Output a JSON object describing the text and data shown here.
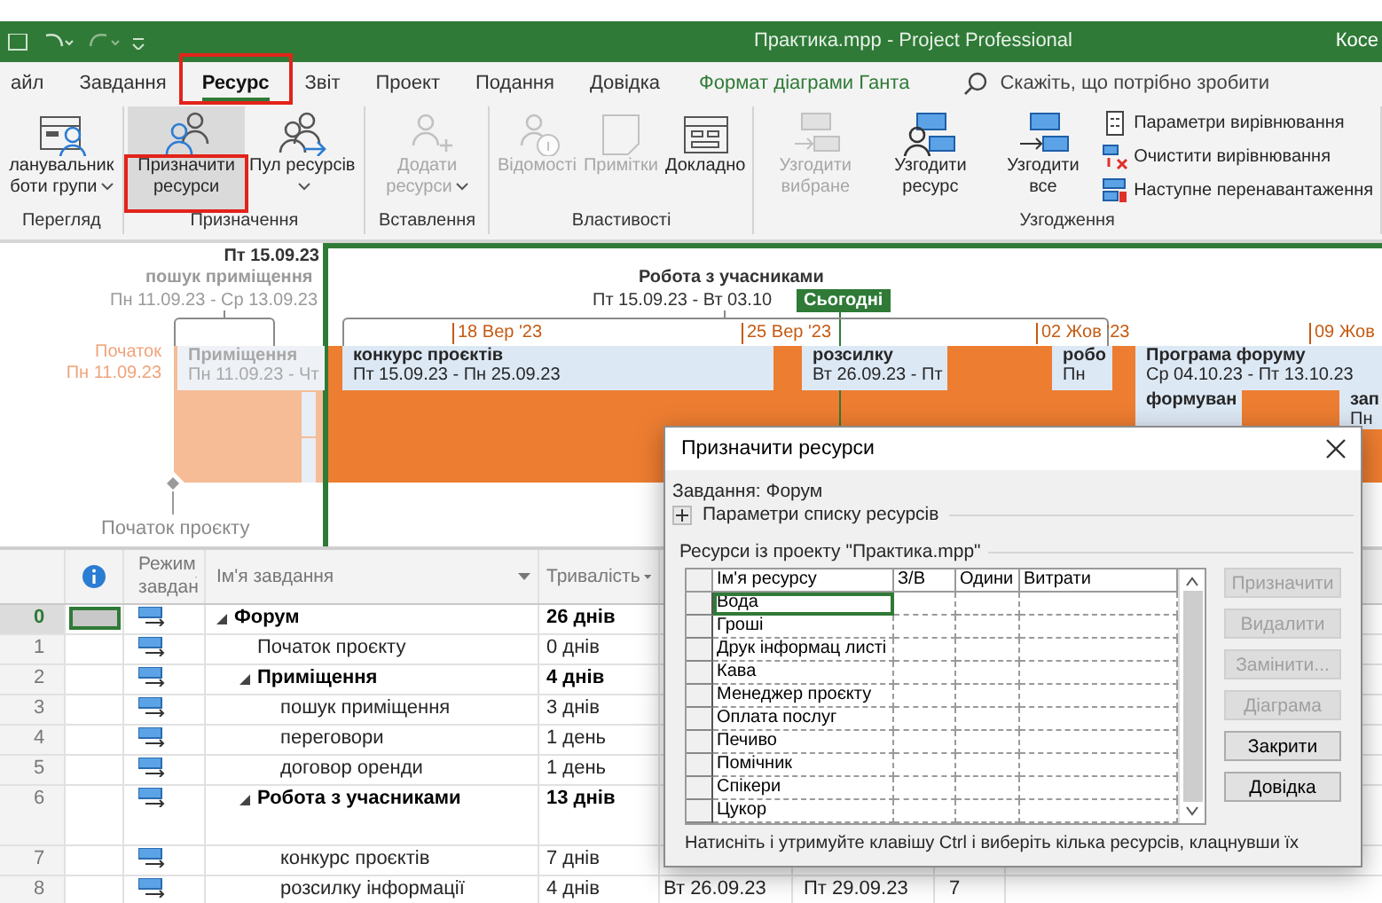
{
  "window": {
    "title": "Практика.mpp  -  Project Professional",
    "user": "Косе"
  },
  "tabs": [
    {
      "label": "айл",
      "selected": false,
      "highlighted": false
    },
    {
      "label": "Завдання",
      "selected": false,
      "highlighted": false
    },
    {
      "label": "Ресурс",
      "selected": true,
      "highlighted": true
    },
    {
      "label": "Звіт",
      "selected": false,
      "highlighted": false
    },
    {
      "label": "Проект",
      "selected": false,
      "highlighted": false
    },
    {
      "label": "Подання",
      "selected": false,
      "highlighted": false
    },
    {
      "label": "Довідка",
      "selected": false,
      "highlighted": false
    }
  ],
  "tool_tab": {
    "label": "Формат діаграми Ганта"
  },
  "tell_me": {
    "placeholder": "Скажіть, що потрібно зробити"
  },
  "ribbon": {
    "groups": [
      {
        "label": "Перегляд",
        "buttons": [
          {
            "kind": "large",
            "label": "ланувальник боти групи",
            "dropdown": true,
            "disabled": false,
            "selected": false,
            "highlighted": false
          }
        ]
      },
      {
        "label": "Призначення",
        "buttons": [
          {
            "kind": "large",
            "label": "Призначити ресурси",
            "dropdown": false,
            "disabled": false,
            "selected": true,
            "highlighted": true
          },
          {
            "kind": "large",
            "label": "Пул ресурсів",
            "dropdown": true,
            "disabled": false,
            "selected": false,
            "highlighted": false
          }
        ]
      },
      {
        "label": "Вставлення",
        "buttons": [
          {
            "kind": "large",
            "label": "Додати ресурси",
            "dropdown": true,
            "disabled": true,
            "selected": false,
            "highlighted": false
          }
        ]
      },
      {
        "label": "Властивості",
        "buttons": [
          {
            "kind": "large",
            "label": "Відомості",
            "dropdown": false,
            "disabled": true,
            "selected": false,
            "highlighted": false
          },
          {
            "kind": "large",
            "label": "Примітки",
            "dropdown": false,
            "disabled": true,
            "selected": false,
            "highlighted": false
          },
          {
            "kind": "large",
            "label": "Докладно",
            "dropdown": false,
            "disabled": false,
            "selected": false,
            "highlighted": false
          }
        ]
      },
      {
        "label": "Узгодження",
        "buttons": [
          {
            "kind": "large",
            "label": "Узгодити вибране",
            "dropdown": false,
            "disabled": true,
            "selected": false,
            "highlighted": false
          },
          {
            "kind": "large",
            "label": "Узгодити ресурс",
            "dropdown": false,
            "disabled": false,
            "selected": false,
            "highlighted": false
          },
          {
            "kind": "large",
            "label": "Узгодити все",
            "dropdown": false,
            "disabled": false,
            "selected": false,
            "highlighted": false
          },
          {
            "kind": "small",
            "label": "Параметри вирівнювання",
            "dropdown": false,
            "disabled": false,
            "selected": false,
            "highlighted": false
          },
          {
            "kind": "small",
            "label": "Очистити вирівнювання",
            "dropdown": false,
            "disabled": false,
            "selected": false,
            "highlighted": false
          },
          {
            "kind": "small",
            "label": "Наступне перенавантаження",
            "dropdown": false,
            "disabled": false,
            "selected": false,
            "highlighted": false
          }
        ]
      }
    ]
  },
  "timeline": {
    "marker_date": "Пт 15.09.23",
    "callouts": [
      {
        "name": "пошук приміщення",
        "dates": "Пн 11.09.23 - Ср 13.09.23"
      },
      {
        "name": "Робота з учасниками",
        "dates": "Пт 15.09.23 - Вт 03.10"
      }
    ],
    "start": {
      "label": "Початок",
      "date": "Пн 11.09.23"
    },
    "today": "Сьогодні",
    "scale": [
      "18 Вер '23",
      "25 Вер '23",
      "02 Жов '23",
      "09 Жов"
    ],
    "bars": [
      {
        "name": "Приміщення",
        "dates": "Пн 11.09.23 - Чт"
      },
      {
        "name": "конкурс проєктів",
        "dates": "Пт 15.09.23 - Пн 25.09.23"
      },
      {
        "name": "розсилку",
        "dates": "Вт 26.09.23 - Пт"
      },
      {
        "name": "робо",
        "dates": "Пн"
      },
      {
        "name": "Програма форуму",
        "dates": "Ср 04.10.23 - Пт 13.10.23"
      },
      {
        "name": "формуван"
      },
      {
        "name": "зап",
        "dates": "Пн"
      }
    ],
    "milestone": "Початок проєкту"
  },
  "table": {
    "columns": [
      {
        "label": "Режим завдан"
      },
      {
        "label": "Ім'я завдання"
      },
      {
        "label": "Тривалість"
      }
    ],
    "rows": [
      {
        "id": "0",
        "name": "Форум",
        "duration": "26 днів",
        "selected": true,
        "expanded": true,
        "children": [
          {
            "id": "1",
            "name": "Початок проєкту",
            "duration": "0 днів",
            "selected": false
          },
          {
            "id": "2",
            "name": "Приміщення",
            "duration": "4 днів",
            "selected": false,
            "expanded": true,
            "children": [
              {
                "id": "3",
                "name": "пошук приміщення",
                "duration": "3 днів",
                "selected": false
              },
              {
                "id": "4",
                "name": "переговори",
                "duration": "1 день",
                "selected": false
              },
              {
                "id": "5",
                "name": "договор оренди",
                "duration": "1 день",
                "selected": false
              }
            ]
          },
          {
            "id": "6",
            "name": "Робота з учасниками",
            "duration": "13 днів",
            "selected": false,
            "expanded": true,
            "children": [
              {
                "id": "7",
                "name": "конкурс проєктів",
                "duration": "7 днів",
                "selected": false
              },
              {
                "id": "8",
                "name": "розсилку інформації",
                "duration": "4 днів",
                "selected": false,
                "start": "Вт 26.09.23",
                "finish": "Пт 29.09.23",
                "predecessors": "7"
              }
            ]
          }
        ]
      }
    ]
  },
  "dialog": {
    "title": "Призначити ресурси",
    "task": "Завдання: Форум",
    "options": {
      "label": "Параметри списку ресурсів",
      "expanded": false
    },
    "list_label": "Ресурси із проекту \"Практика.mpp\"",
    "columns": [
      "Ім'я ресурсу",
      "З/В",
      "Одини",
      "Витрати"
    ],
    "resources": [
      {
        "name": "Вода",
        "selected": true
      },
      {
        "name": "Гроші",
        "selected": false
      },
      {
        "name": "Друк інформац листі",
        "selected": false
      },
      {
        "name": "Кава",
        "selected": false
      },
      {
        "name": "Менеджер проєкту",
        "selected": false
      },
      {
        "name": "Оплата послуг",
        "selected": false
      },
      {
        "name": "Печиво",
        "selected": false
      },
      {
        "name": "Помічник",
        "selected": false
      },
      {
        "name": "Спікери",
        "selected": false
      },
      {
        "name": "Цукор",
        "selected": false
      }
    ],
    "buttons": [
      {
        "label": "Призначити",
        "disabled": true
      },
      {
        "label": "Видалити",
        "disabled": true
      },
      {
        "label": "Замінити...",
        "disabled": true
      },
      {
        "label": "Діаграма",
        "disabled": true
      },
      {
        "label": "Закрити",
        "disabled": false
      },
      {
        "label": "Довідка",
        "disabled": false
      }
    ],
    "hint": "Натисніть і утримуйте клавішу Ctrl і виберіть кілька ресурсів, клацнувши їх"
  }
}
